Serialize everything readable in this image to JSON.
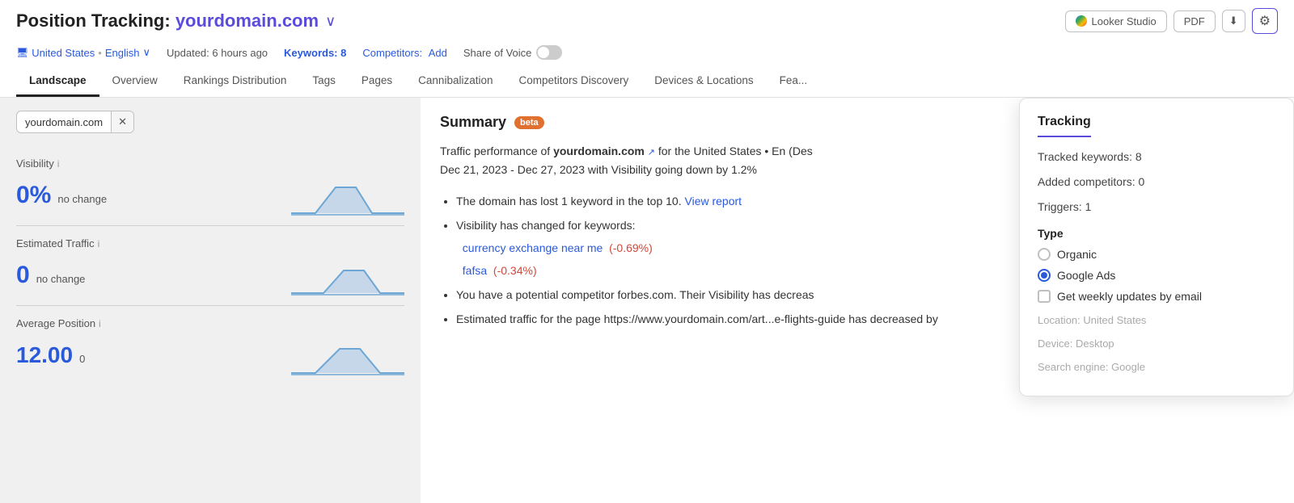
{
  "header": {
    "title_prefix": "Position Tracking: ",
    "domain": "yourdomain.com",
    "dropdown_arrow": "∨",
    "location": "United States",
    "lang": "English",
    "location_chevron": "∨",
    "updated": "Updated: 6 hours ago",
    "keywords_label": "Keywords:",
    "keywords_count": "8",
    "competitors_label": "Competitors:",
    "competitors_add": "Add",
    "sov_label": "Share of Voice"
  },
  "toolbar": {
    "looker_label": "Looker Studio",
    "pdf_label": "PDF",
    "export_icon": "⬇",
    "settings_icon": "⚙"
  },
  "tabs": [
    {
      "label": "Landscape",
      "active": true
    },
    {
      "label": "Overview",
      "active": false
    },
    {
      "label": "Rankings Distribution",
      "active": false
    },
    {
      "label": "Tags",
      "active": false
    },
    {
      "label": "Pages",
      "active": false
    },
    {
      "label": "Cannibalization",
      "active": false
    },
    {
      "label": "Competitors Discovery",
      "active": false
    },
    {
      "label": "Devices & Locations",
      "active": false
    },
    {
      "label": "Fea...",
      "active": false
    }
  ],
  "filter": {
    "domain": "yourdomain.com",
    "close": "✕"
  },
  "metrics": [
    {
      "label": "Visibility",
      "info": "i",
      "value": "0%",
      "change": "no change"
    },
    {
      "label": "Estimated Traffic",
      "info": "i",
      "value": "0",
      "change": "no change"
    },
    {
      "label": "Average Position",
      "info": "i",
      "value": "12.00",
      "change": "0"
    }
  ],
  "summary": {
    "title": "Summary",
    "badge": "beta",
    "intro_part1": "Traffic performance of ",
    "intro_domain": "yourdomain.com",
    "intro_part2": " for the United States • En (Des",
    "intro_part3": "Dec 21, 2023 - Dec 27, 2023 with Visibility going down by 1.2%",
    "bullets": [
      {
        "text_before": "The domain has lost 1 keyword in the top 10.",
        "link": "View report",
        "text_after": ""
      },
      {
        "text_before": "Visibility has changed for keywords:",
        "link": "",
        "text_after": ""
      },
      {
        "keyword1": "currency exchange near me",
        "change1": "(-0.69%)",
        "keyword2": "fafsa",
        "change2": "(-0.34%)"
      },
      {
        "text_before": "You have a potential competitor forbes.com. Their Visibility has decreas",
        "link": "",
        "text_after": ""
      },
      {
        "text_before": "Estimated traffic for the page https://www.yourdomain.com/art...e-flights-guide has decreased by",
        "link": "",
        "text_after": ""
      }
    ]
  },
  "tracking_panel": {
    "title": "Tracking",
    "tracked_keywords_label": "Tracked keywords:",
    "tracked_keywords_value": "8",
    "added_competitors_label": "Added competitors:",
    "added_competitors_value": "0",
    "triggers_label": "Triggers:",
    "triggers_value": "1",
    "type_section": "Type",
    "type_options": [
      {
        "label": "Organic",
        "selected": false
      },
      {
        "label": "Google Ads",
        "selected": true
      }
    ],
    "email_label": "Get weekly updates by email",
    "location_placeholder": "Location: United States",
    "device_placeholder": "Device: Desktop",
    "search_engine_placeholder": "Search engine: Google"
  },
  "colors": {
    "accent_blue": "#2a5adb",
    "accent_purple": "#5b4bdb",
    "negative": "#d0483a",
    "warning_orange": "#e07030"
  }
}
